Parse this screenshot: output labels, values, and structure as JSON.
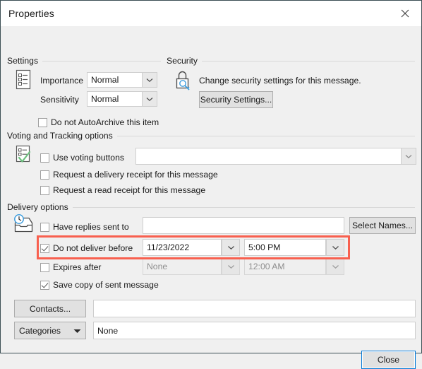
{
  "window": {
    "title": "Properties",
    "close_icon": "close-icon"
  },
  "settings": {
    "group_label": "Settings",
    "icon": "message-options-icon",
    "importance_label": "Importance",
    "importance_value": "Normal",
    "sensitivity_label": "Sensitivity",
    "sensitivity_value": "Normal",
    "autoarchive_label": "Do not AutoArchive this item",
    "autoarchive_checked": false
  },
  "security": {
    "group_label": "Security",
    "icon": "lock-key-icon",
    "description": "Change security settings for this message.",
    "button_label": "Security Settings..."
  },
  "voting": {
    "group_label": "Voting and Tracking options",
    "icon": "voting-checklist-icon",
    "use_voting_label": "Use voting buttons",
    "use_voting_checked": false,
    "voting_value": "",
    "delivery_receipt_label": "Request a delivery receipt for this message",
    "delivery_receipt_checked": false,
    "read_receipt_label": "Request a read receipt for this message",
    "read_receipt_checked": false
  },
  "delivery": {
    "group_label": "Delivery options",
    "icon": "delayed-delivery-icon",
    "replies_label": "Have replies sent to",
    "replies_checked": false,
    "replies_value": "",
    "select_names_button": "Select Names...",
    "not_before_label": "Do not deliver before",
    "not_before_checked": true,
    "not_before_date": "11/23/2022",
    "not_before_time": "5:00 PM",
    "expires_label": "Expires after",
    "expires_checked": false,
    "expires_date": "None",
    "expires_time": "12:00 AM",
    "save_copy_label": "Save copy of sent message",
    "save_copy_checked": true
  },
  "footer": {
    "contacts_button": "Contacts...",
    "contacts_value": "",
    "categories_button": "Categories",
    "categories_value": "None",
    "close_button": "Close"
  },
  "highlight": {
    "color": "#f8604f",
    "target": "do-not-deliver-before-row"
  }
}
